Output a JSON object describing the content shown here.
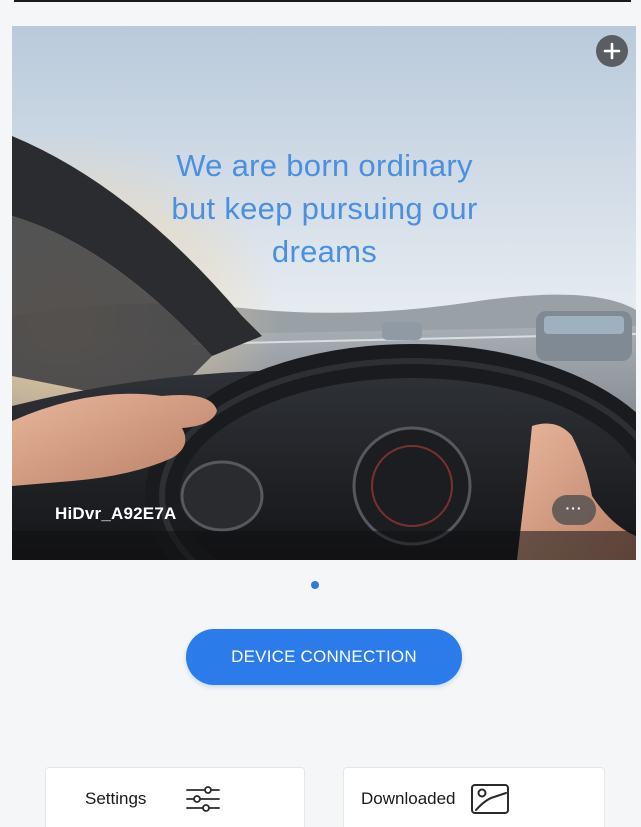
{
  "hero": {
    "slogan_lines": [
      "We are born ordinary",
      "but keep pursuing our",
      "dreams"
    ],
    "device_name": "HiDvr_A92E7A",
    "add_icon": "plus-icon",
    "more_icon": "more-dots-icon",
    "more_label": "···"
  },
  "actions": {
    "connect_label": "DEVICE CONNECTION"
  },
  "bottom": {
    "settings_label": "Settings",
    "settings_icon": "sliders-icon",
    "downloaded_label": "Downloaded",
    "downloaded_icon": "gallery-icon"
  },
  "colors": {
    "accent": "#2b7cea",
    "slogan": "#4a8fe0"
  }
}
